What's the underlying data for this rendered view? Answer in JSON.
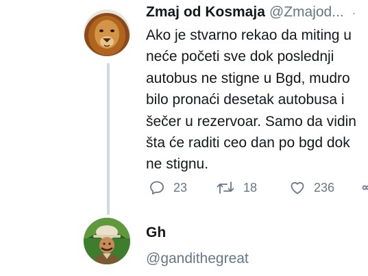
{
  "tweet": {
    "display_name": "Zmaj od Kosmaja",
    "handle": "@Zmajod...",
    "caret": "·",
    "avatar": "lion-avatar",
    "text": "Ako je stvarno rekao da miting u\nneće početi sve dok poslednji\nautobus ne stigne u Bgd, mudro\nbilo pronaći desetak autobusa i\nšečer u rezervoar. Samo da vidin\nšta će raditi ceo dan po bgd dok\nne stignu.",
    "actions": {
      "reply": {
        "icon": "reply-icon",
        "count": "23"
      },
      "retweet": {
        "icon": "retweet-icon",
        "count": "18"
      },
      "like": {
        "icon": "heart-icon",
        "count": "236"
      },
      "share": {
        "icon": "share-icon"
      }
    }
  },
  "reply_user": {
    "display_name": "Gh",
    "handle": "@gandithegreat",
    "avatar": "explorer-avatar"
  },
  "colors": {
    "text": "#14171a",
    "secondary": "#657786",
    "thread_line": "#cfd9de"
  }
}
